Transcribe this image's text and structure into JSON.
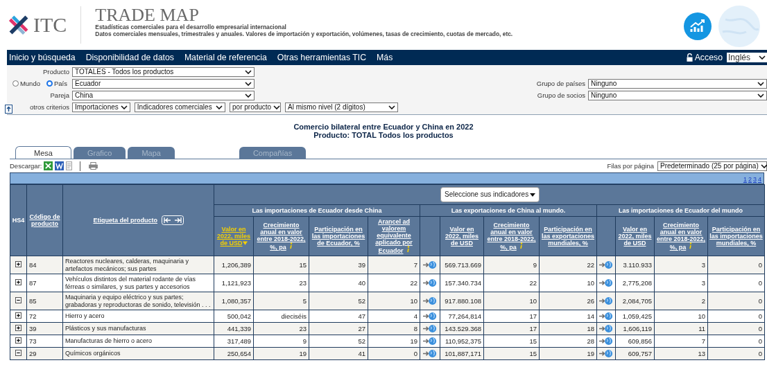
{
  "header": {
    "logo_text": "ITC",
    "title": "TRADE MAP",
    "subtitle_1": "Estadísticas comerciales para el desarrollo empresarial internacional",
    "subtitle_2": "Datos comerciales mensuales, trimestrales y anuales. Valores de importación y exportación, volúmenes, tasas de crecimiento, cuotas de mercado, etc."
  },
  "nav": {
    "items": [
      "Inicio y búsqueda",
      "Disponibilidad de datos",
      "Material de referencia",
      "Otras herramientas TIC",
      "Más"
    ],
    "login": "Acceso",
    "language": "Inglés"
  },
  "form": {
    "product_label": "Producto",
    "product": "TOTALES - Todos los productos",
    "scope": [
      {
        "label": "Mundo",
        "selected": false
      },
      {
        "label": "País",
        "selected": true
      }
    ],
    "country": "Ecuador",
    "partner_label": "Pareja",
    "partner": "China",
    "criteria_label": "otros criterios",
    "criteria": [
      "Importaciones",
      "Indicadores comerciales",
      "por producto",
      "Al mismo nivel (2 dígitos)"
    ],
    "country_group_label": "Grupo de países",
    "country_group": "Ninguno",
    "partner_group_label": "Grupo de socios",
    "partner_group": "Ninguno"
  },
  "report_title": [
    "Comercio bilateral entre Ecuador y China en 2022",
    "Producto: TOTAL Todos los productos"
  ],
  "tabs": [
    {
      "label": "Mesa",
      "selected": true
    },
    {
      "label": "Grafico",
      "selected": false
    },
    {
      "label": "Mapa",
      "selected": false
    },
    {
      "label": "Compañías",
      "selected": false
    }
  ],
  "toolbar": {
    "download_label": "Descargar:",
    "rows_per_page_label": "Filas por página",
    "rows_per_page": "Predeterminado (25 por página)"
  },
  "pages": [
    "1",
    "2",
    "3",
    "4"
  ],
  "table": {
    "fixed_columns": [
      "HS4",
      "Código de producto",
      "Etiqueta del producto"
    ],
    "indicator_selector": "Seleccione sus indicadores",
    "groups": [
      {
        "title": "Las importaciones de Ecuador desde China",
        "link_column": false,
        "columns": [
          {
            "label": "Valor en 2022, miles de USD",
            "sorted": true,
            "info": false
          },
          {
            "label": "Crecimiento anual en valor entre 2018-2022, %, pa",
            "sorted": false,
            "info": true
          },
          {
            "label": "Participación en las importaciones de Ecuador, %",
            "sorted": false,
            "info": false
          },
          {
            "label": "Arancel ad valorem equivalente aplicado por Ecuador",
            "sorted": false,
            "info": true
          }
        ]
      },
      {
        "title": "Las exportaciones de China al mundo.",
        "link_column": true,
        "columns": [
          {
            "label": "Valor en 2022, miles de USD",
            "sorted": false,
            "info": false
          },
          {
            "label": "Crecimiento anual en valor entre 2018-2022, %, pa",
            "sorted": false,
            "info": true
          },
          {
            "label": "Participación en las exportaciones mundiales, %",
            "sorted": false,
            "info": false
          }
        ]
      },
      {
        "title": "Las importaciones de Ecuador del mundo",
        "link_column": true,
        "columns": [
          {
            "label": "Valor en 2022, miles de USD",
            "sorted": false,
            "info": false
          },
          {
            "label": "Crecimiento anual en valor entre 2018-2022, %, pa",
            "sorted": false,
            "info": true
          },
          {
            "label": "Participación en las importaciones mundiales, %",
            "sorted": false,
            "info": false
          }
        ]
      }
    ],
    "rows": [
      {
        "expanded": false,
        "code": "84",
        "label": "Reactores nucleares, calderas, maquinaria y artefactos mecánicos; sus partes",
        "values": [
          [
            "1,206,389",
            "15",
            "39",
            "7"
          ],
          [
            "569.713.669",
            "9",
            "22"
          ],
          [
            "3.110.933",
            "3",
            "0"
          ]
        ]
      },
      {
        "expanded": false,
        "code": "87",
        "label": "Vehículos distintos del material rodante de vías férreas o similares, y sus partes y accesorios",
        "values": [
          [
            "1,121,923",
            "23",
            "40",
            "22"
          ],
          [
            "157.340.734",
            "22",
            "10"
          ],
          [
            "2,775,208",
            "3",
            "0"
          ]
        ]
      },
      {
        "expanded": true,
        "code": "85",
        "label": "Maquinaria y equipo eléctrico y sus partes; grabadoras y reproductoras de sonido, televisión . . .",
        "values": [
          [
            "1,080,357",
            "5",
            "52",
            "10"
          ],
          [
            "917.880.108",
            "10",
            "26"
          ],
          [
            "2,084,705",
            "2",
            "0"
          ]
        ]
      },
      {
        "expanded": false,
        "code": "72",
        "label": "Hierro y acero",
        "values": [
          [
            "500,042",
            "dieciséis",
            "47",
            "4"
          ],
          [
            "77,264,814",
            "17",
            "14"
          ],
          [
            "1,059,425",
            "10",
            "0"
          ]
        ]
      },
      {
        "expanded": false,
        "code": "39",
        "label": "Plásticos y sus manufacturas",
        "values": [
          [
            "441,339",
            "23",
            "27",
            "8"
          ],
          [
            "143.529.368",
            "17",
            "18"
          ],
          [
            "1,606,119",
            "11",
            "0"
          ]
        ]
      },
      {
        "expanded": false,
        "code": "73",
        "label": "Manufacturas de hierro o acero",
        "values": [
          [
            "317,489",
            "9",
            "52",
            "19"
          ],
          [
            "110,952,375",
            "15",
            "28"
          ],
          [
            "609,856",
            "7",
            "0"
          ]
        ]
      },
      {
        "expanded": true,
        "code": "29",
        "label": "Químicos orgánicos",
        "values": [
          [
            "250,654",
            "19",
            "41",
            "0"
          ],
          [
            "101,887,171",
            "15",
            "19"
          ],
          [
            "609,757",
            "13",
            "0"
          ]
        ]
      }
    ]
  }
}
